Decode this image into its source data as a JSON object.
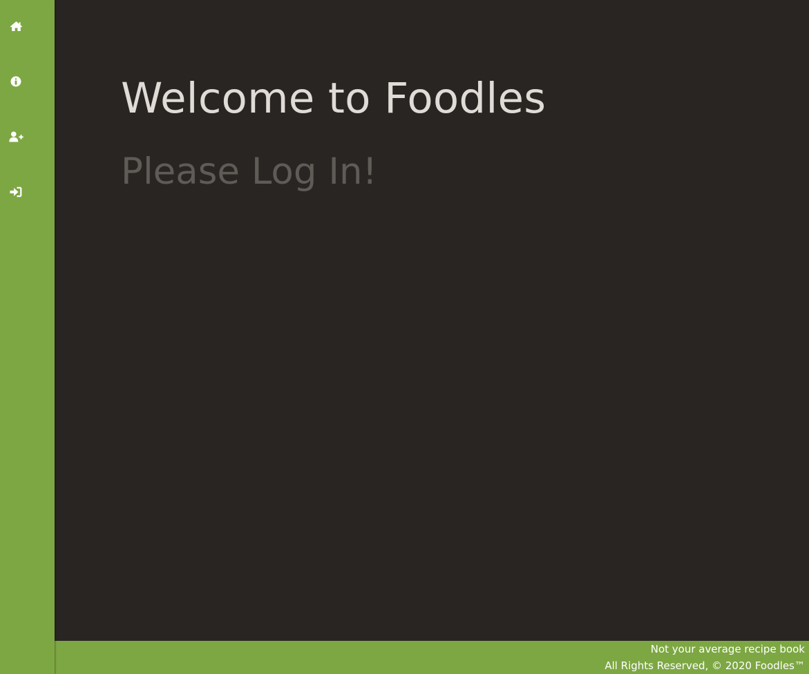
{
  "app": {
    "colors": {
      "sidebar_bg": "#7da743",
      "main_bg": "#292522",
      "heading": "#e0dbd6",
      "subheading": "#5f5b56",
      "footer_text": "#ffffff"
    }
  },
  "sidebar": {
    "items": [
      {
        "id": "home",
        "icon": "home-icon"
      },
      {
        "id": "info",
        "icon": "info-circle-icon"
      },
      {
        "id": "register",
        "icon": "user-plus-icon"
      },
      {
        "id": "login",
        "icon": "sign-in-icon"
      }
    ]
  },
  "main": {
    "title": "Welcome to Foodles",
    "subtitle": "Please Log In!"
  },
  "footer": {
    "tagline": "Not your average recipe book",
    "copyright": "All Rights Reserved, © 2020 Foodles™"
  }
}
